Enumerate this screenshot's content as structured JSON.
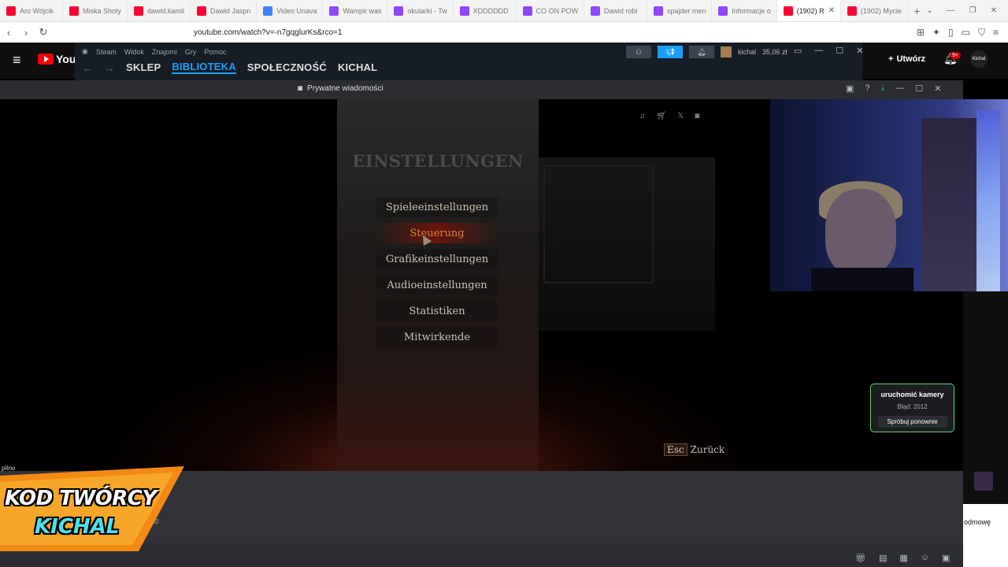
{
  "browser": {
    "tabs": [
      {
        "label": "Aro Wójcik",
        "color": "#ff0033"
      },
      {
        "label": "Miska Shoty",
        "color": "#ff0033"
      },
      {
        "label": "dawid.kamil",
        "color": "#ff0033"
      },
      {
        "label": "Dawid Jaspn",
        "color": "#ff0033"
      },
      {
        "label": "Video Unava",
        "color": "#3b82f6"
      },
      {
        "label": "Wampir was",
        "color": "#9146ff"
      },
      {
        "label": "okularki - Tw",
        "color": "#9146ff"
      },
      {
        "label": "XDDDDDD",
        "color": "#9146ff"
      },
      {
        "label": "CO ON POW",
        "color": "#9146ff"
      },
      {
        "label": "Dawid robi",
        "color": "#9146ff"
      },
      {
        "label": "spajder men",
        "color": "#9146ff"
      },
      {
        "label": "Informacje o",
        "color": "#9146ff"
      },
      {
        "label": "(1902) R",
        "color": "#ff0033",
        "active": true
      },
      {
        "label": "(1902) Mycie",
        "color": "#ff0033"
      }
    ],
    "url": "youtube.com/watch?v=-n7gqglurKs&rco=1"
  },
  "youtube": {
    "logo_text": "YouT",
    "create_label": "Utwórz",
    "notif_badge": "9+",
    "avatar_text": "Kichal"
  },
  "steam": {
    "menu": [
      "Steam",
      "Widok",
      "Znajomi",
      "Gry",
      "Pomoc"
    ],
    "nav": [
      "SKLEP",
      "BIBLIOTEKA",
      "SPOŁECZNOŚĆ",
      "KICHAL"
    ],
    "active_nav": "BIBLIOTEKA",
    "username": "kichal",
    "balance": "35,06 zł"
  },
  "overlay": {
    "title": "Prywatne wiadomości"
  },
  "game": {
    "title": "EINSTELLUNGEN",
    "menu": [
      "Spieleeinstellungen",
      "Steuerung",
      "Grafikeinstellungen",
      "Audioeinstellungen",
      "Statistiken",
      "Mitwirkende"
    ],
    "selected": "Steuerung",
    "esc_key": "Esc",
    "esc_label": "Zurück"
  },
  "camera_error": {
    "title": "uruchomić kamery",
    "error": "Błąd: 2012",
    "retry": "Spróbuj ponownie"
  },
  "chat": {
    "line": "pitno",
    "timestamp": "1:40"
  },
  "sidebar_right": {
    "text": "odmowę"
  },
  "promo": {
    "line1": "KOD TWÓRCY",
    "line2": "KICHAL"
  }
}
